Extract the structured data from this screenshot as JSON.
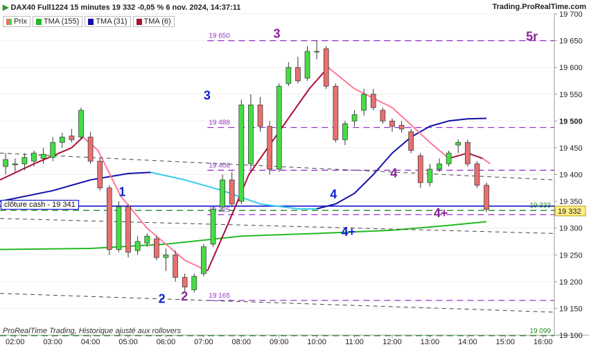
{
  "header": {
    "title": "DAX40 Full1224 15 minutes 19 332 -0,05 % 6 nov. 2024, 14:37:11",
    "brand": "Trading.ProRealTime.com"
  },
  "legend": [
    {
      "label": "Prix",
      "color": "#e87070"
    },
    {
      "label": "TMA (155)",
      "color": "#22bb22"
    },
    {
      "label": "TMA (31)",
      "color": "#1111aa"
    },
    {
      "label": "TMA (6)",
      "color": "#aa1133"
    }
  ],
  "footer_note": "ProRealTime Trading, Historique ajusté aux rollovers",
  "chart_data": {
    "type": "candlestick",
    "ylim": [
      19100,
      19700
    ],
    "y_ticks": [
      19100,
      19150,
      19200,
      19250,
      19300,
      19350,
      19400,
      19450,
      19500,
      19550,
      19600,
      19650,
      19700
    ],
    "y_tick_labels": [
      "19 100",
      "19 150",
      "19 200",
      "19 250",
      "19 300",
      "19 350",
      "19 400",
      "19 450",
      "19 500",
      "19 550",
      "19 600",
      "19 650",
      "19 700"
    ],
    "x_tick_labels": [
      "02:00",
      "03:00",
      "04:00",
      "05:00",
      "06:00",
      "07:00",
      "08:00",
      "09:00",
      "10:00",
      "11:00",
      "12:00",
      "13:00",
      "14:00",
      "15:00",
      "16:00"
    ],
    "x_range_hours": [
      1.6,
      16.3
    ],
    "last_price_label": "19 332",
    "last_price": 19332,
    "bold_price_label": "19 500",
    "candles": [
      {
        "t": 1.75,
        "o": 19415,
        "h": 19440,
        "l": 19400,
        "c": 19428
      },
      {
        "t": 2.0,
        "o": 19418,
        "h": 19430,
        "l": 19405,
        "c": 19420
      },
      {
        "t": 2.25,
        "o": 19420,
        "h": 19440,
        "l": 19408,
        "c": 19432
      },
      {
        "t": 2.5,
        "o": 19425,
        "h": 19445,
        "l": 19415,
        "c": 19440
      },
      {
        "t": 2.75,
        "o": 19430,
        "h": 19450,
        "l": 19420,
        "c": 19438
      },
      {
        "t": 3.0,
        "o": 19432,
        "h": 19470,
        "l": 19425,
        "c": 19460
      },
      {
        "t": 3.25,
        "o": 19460,
        "h": 19478,
        "l": 19450,
        "c": 19470
      },
      {
        "t": 3.5,
        "o": 19472,
        "h": 19485,
        "l": 19460,
        "c": 19465
      },
      {
        "t": 3.75,
        "o": 19470,
        "h": 19525,
        "l": 19465,
        "c": 19520
      },
      {
        "t": 4.0,
        "o": 19470,
        "h": 19480,
        "l": 19420,
        "c": 19425
      },
      {
        "t": 4.25,
        "o": 19425,
        "h": 19430,
        "l": 19370,
        "c": 19375
      },
      {
        "t": 4.5,
        "o": 19375,
        "h": 19380,
        "l": 19250,
        "c": 19260
      },
      {
        "t": 4.75,
        "o": 19260,
        "h": 19350,
        "l": 19255,
        "c": 19340
      },
      {
        "t": 5.0,
        "o": 19340,
        "h": 19345,
        "l": 19245,
        "c": 19255
      },
      {
        "t": 5.25,
        "o": 19258,
        "h": 19285,
        "l": 19250,
        "c": 19275
      },
      {
        "t": 5.5,
        "o": 19272,
        "h": 19290,
        "l": 19265,
        "c": 19285
      },
      {
        "t": 5.75,
        "o": 19280,
        "h": 19285,
        "l": 19240,
        "c": 19245
      },
      {
        "t": 6.0,
        "o": 19245,
        "h": 19262,
        "l": 19220,
        "c": 19250
      },
      {
        "t": 6.25,
        "o": 19250,
        "h": 19258,
        "l": 19200,
        "c": 19208
      },
      {
        "t": 6.5,
        "o": 19208,
        "h": 19215,
        "l": 19180,
        "c": 19190
      },
      {
        "t": 6.75,
        "o": 19185,
        "h": 19215,
        "l": 19180,
        "c": 19210
      },
      {
        "t": 7.0,
        "o": 19215,
        "h": 19270,
        "l": 19210,
        "c": 19265
      },
      {
        "t": 7.25,
        "o": 19270,
        "h": 19340,
        "l": 19265,
        "c": 19335
      },
      {
        "t": 7.5,
        "o": 19340,
        "h": 19400,
        "l": 19335,
        "c": 19390
      },
      {
        "t": 7.75,
        "o": 19390,
        "h": 19405,
        "l": 19340,
        "c": 19345
      },
      {
        "t": 8.0,
        "o": 19350,
        "h": 19540,
        "l": 19345,
        "c": 19530
      },
      {
        "t": 8.25,
        "o": 19420,
        "h": 19550,
        "l": 19410,
        "c": 19530
      },
      {
        "t": 8.5,
        "o": 19530,
        "h": 19545,
        "l": 19480,
        "c": 19490
      },
      {
        "t": 8.75,
        "o": 19490,
        "h": 19500,
        "l": 19400,
        "c": 19410
      },
      {
        "t": 9.0,
        "o": 19410,
        "h": 19570,
        "l": 19405,
        "c": 19565
      },
      {
        "t": 9.25,
        "o": 19570,
        "h": 19610,
        "l": 19565,
        "c": 19600
      },
      {
        "t": 9.5,
        "o": 19600,
        "h": 19620,
        "l": 19570,
        "c": 19575
      },
      {
        "t": 9.75,
        "o": 19580,
        "h": 19640,
        "l": 19575,
        "c": 19630
      },
      {
        "t": 10.0,
        "o": 19630,
        "h": 19650,
        "l": 19615,
        "c": 19630
      },
      {
        "t": 10.25,
        "o": 19635,
        "h": 19640,
        "l": 19560,
        "c": 19565
      },
      {
        "t": 10.5,
        "o": 19565,
        "h": 19570,
        "l": 19460,
        "c": 19465
      },
      {
        "t": 10.75,
        "o": 19465,
        "h": 19500,
        "l": 19455,
        "c": 19495
      },
      {
        "t": 11.0,
        "o": 19500,
        "h": 19520,
        "l": 19490,
        "c": 19512
      },
      {
        "t": 11.25,
        "o": 19520,
        "h": 19560,
        "l": 19510,
        "c": 19550
      },
      {
        "t": 11.5,
        "o": 19550,
        "h": 19560,
        "l": 19520,
        "c": 19525
      },
      {
        "t": 11.75,
        "o": 19520,
        "h": 19525,
        "l": 19495,
        "c": 19500
      },
      {
        "t": 12.0,
        "o": 19500,
        "h": 19505,
        "l": 19480,
        "c": 19490
      },
      {
        "t": 12.25,
        "o": 19492,
        "h": 19500,
        "l": 19478,
        "c": 19485
      },
      {
        "t": 12.5,
        "o": 19480,
        "h": 19485,
        "l": 19440,
        "c": 19445
      },
      {
        "t": 12.75,
        "o": 19435,
        "h": 19440,
        "l": 19375,
        "c": 19385
      },
      {
        "t": 13.0,
        "o": 19385,
        "h": 19420,
        "l": 19378,
        "c": 19410
      },
      {
        "t": 13.25,
        "o": 19410,
        "h": 19430,
        "l": 19405,
        "c": 19420
      },
      {
        "t": 13.5,
        "o": 19420,
        "h": 19445,
        "l": 19415,
        "c": 19440
      },
      {
        "t": 13.75,
        "o": 19455,
        "h": 19465,
        "l": 19440,
        "c": 19460
      },
      {
        "t": 14.0,
        "o": 19460,
        "h": 19465,
        "l": 19415,
        "c": 19420
      },
      {
        "t": 14.25,
        "o": 19420,
        "h": 19425,
        "l": 19375,
        "c": 19380
      },
      {
        "t": 14.5,
        "o": 19380,
        "h": 19385,
        "l": 19330,
        "c": 19335
      }
    ],
    "lines": [
      {
        "name": "TMA (155)",
        "color": "#22bb22",
        "width": 2,
        "dash": "",
        "points": [
          [
            1.6,
            19260
          ],
          [
            4.0,
            19262
          ],
          [
            6.0,
            19270
          ],
          [
            8.0,
            19285
          ],
          [
            10.0,
            19290
          ],
          [
            12.0,
            19296
          ],
          [
            13.5,
            19305
          ],
          [
            14.5,
            19312
          ]
        ]
      },
      {
        "name": "TMA (31)",
        "color": "#1111aa",
        "width": 2,
        "dash": "",
        "points": [
          [
            1.6,
            19350
          ],
          [
            3.0,
            19370
          ],
          [
            4.0,
            19390
          ],
          [
            5.0,
            19402
          ],
          [
            5.6,
            19404
          ]
        ]
      },
      {
        "name": "TMA (31) cyan",
        "color": "#33ccee",
        "width": 2,
        "dash": "",
        "points": [
          [
            5.6,
            19404
          ],
          [
            6.5,
            19390
          ],
          [
            7.5,
            19370
          ],
          [
            8.5,
            19345
          ],
          [
            9.5,
            19336
          ],
          [
            10.0,
            19336
          ]
        ]
      },
      {
        "name": "TMA (31) blue",
        "color": "#1111aa",
        "width": 2,
        "dash": "",
        "points": [
          [
            10.0,
            19336
          ],
          [
            10.5,
            19345
          ],
          [
            11.0,
            19365
          ],
          [
            11.5,
            19400
          ],
          [
            12.0,
            19440
          ],
          [
            12.5,
            19470
          ],
          [
            13.0,
            19490
          ],
          [
            13.5,
            19500
          ],
          [
            14.0,
            19504
          ],
          [
            14.5,
            19505
          ]
        ]
      },
      {
        "name": "TMA (6) red",
        "color": "#aa1133",
        "width": 2,
        "dash": "",
        "points": [
          [
            1.6,
            19390
          ],
          [
            2.5,
            19420
          ],
          [
            3.5,
            19450
          ],
          [
            3.8,
            19470
          ]
        ]
      },
      {
        "name": "TMA (6) pink",
        "color": "#ff7799",
        "width": 2,
        "dash": "",
        "points": [
          [
            3.8,
            19470
          ],
          [
            4.2,
            19445
          ],
          [
            4.8,
            19360
          ],
          [
            5.5,
            19300
          ],
          [
            6.5,
            19240
          ],
          [
            7.1,
            19220
          ]
        ]
      },
      {
        "name": "TMA (6) red2",
        "color": "#aa1133",
        "width": 2,
        "dash": "",
        "points": [
          [
            7.1,
            19220
          ],
          [
            7.6,
            19300
          ],
          [
            8.2,
            19400
          ],
          [
            9.0,
            19480
          ],
          [
            9.8,
            19560
          ],
          [
            10.3,
            19600
          ]
        ]
      },
      {
        "name": "TMA (6) pink2",
        "color": "#ff7799",
        "width": 2,
        "dash": "",
        "points": [
          [
            10.3,
            19600
          ],
          [
            11.0,
            19560
          ],
          [
            12.0,
            19525
          ],
          [
            13.0,
            19460
          ],
          [
            13.5,
            19430
          ]
        ]
      },
      {
        "name": "TMA (6) red3",
        "color": "#aa1133",
        "width": 2,
        "dash": "",
        "points": [
          [
            13.5,
            19430
          ],
          [
            14.0,
            19440
          ],
          [
            14.4,
            19430
          ]
        ]
      },
      {
        "name": "TMA (6) pink3",
        "color": "#ff7799",
        "width": 2,
        "dash": "",
        "points": [
          [
            14.4,
            19430
          ],
          [
            14.6,
            19420
          ]
        ]
      },
      {
        "name": "trend1",
        "color": "#444444",
        "width": 1,
        "dash": "6,5",
        "points": [
          [
            1.6,
            19440
          ],
          [
            16.3,
            19390
          ]
        ]
      },
      {
        "name": "trend2",
        "color": "#444444",
        "width": 1,
        "dash": "6,5",
        "points": [
          [
            1.6,
            19318
          ],
          [
            16.3,
            19290
          ]
        ]
      },
      {
        "name": "trend3",
        "color": "#444444",
        "width": 1,
        "dash": "6,5",
        "points": [
          [
            1.6,
            19178
          ],
          [
            16.3,
            19143
          ]
        ]
      }
    ],
    "hlines": [
      {
        "value": 19650,
        "color": "#9933cc",
        "dash": "9,6",
        "from": 7.1,
        "label": "19 650",
        "side": "left"
      },
      {
        "value": 19488,
        "color": "#9933cc",
        "dash": "9,6",
        "from": 7.1,
        "label": "19 488",
        "side": "left"
      },
      {
        "value": 19408,
        "color": "#9933cc",
        "dash": "9,6",
        "from": 7.1,
        "label": "19 408",
        "side": "left"
      },
      {
        "value": 19325,
        "color": "#9933cc",
        "dash": "9,6",
        "from": 7.1,
        "label": "19 325",
        "side": "left"
      },
      {
        "value": 19165,
        "color": "#9933cc",
        "dash": "9,6",
        "from": 7.1,
        "label": "19 165",
        "side": "left"
      },
      {
        "value": 19341,
        "color": "#0000cc",
        "dash": "",
        "from": 1.6,
        "width": 1.5,
        "label": "",
        "side": ""
      },
      {
        "value": 19333,
        "color": "#228822",
        "dash": "9,6",
        "from": 1.6,
        "label": "19 333",
        "side": "right"
      },
      {
        "value": 19099,
        "color": "#228822",
        "dash": "9,6",
        "from": 1.6,
        "label": "19 099",
        "side": "right"
      }
    ],
    "annotations": [
      {
        "text": "1",
        "t": 4.75,
        "y": 19360,
        "color": "#1122cc",
        "size": 18
      },
      {
        "text": "2",
        "t": 5.8,
        "y": 19160,
        "color": "#1122cc",
        "size": 18
      },
      {
        "text": "2",
        "t": 6.4,
        "y": 19165,
        "color": "#882299",
        "size": 18
      },
      {
        "text": "3",
        "t": 7.0,
        "y": 19540,
        "color": "#1122cc",
        "size": 18
      },
      {
        "text": "3",
        "t": 8.85,
        "y": 19655,
        "color": "#882299",
        "size": 18
      },
      {
        "text": "4",
        "t": 10.35,
        "y": 19355,
        "color": "#1122cc",
        "size": 18
      },
      {
        "text": "4",
        "t": 11.95,
        "y": 19395,
        "color": "#882299",
        "size": 18
      },
      {
        "text": "4+",
        "t": 10.65,
        "y": 19285,
        "color": "#1122cc",
        "size": 18
      },
      {
        "text": "4+",
        "t": 13.1,
        "y": 19320,
        "color": "#882299",
        "size": 18
      },
      {
        "text": "5r",
        "t": 15.55,
        "y": 19650,
        "color": "#882299",
        "size": 18
      }
    ],
    "close_cash_label": "clôture cash -  19 341"
  }
}
